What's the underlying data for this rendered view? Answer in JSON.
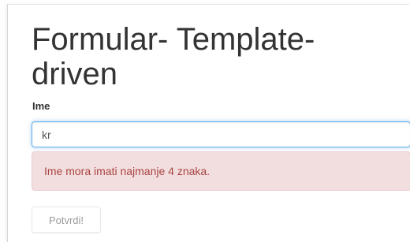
{
  "form": {
    "title": "Formular- Template-driven",
    "field_label": "Ime",
    "field_value": "kr",
    "error_message": "Ime mora imati najmanje 4 znaka.",
    "submit_label": "Potvrdi!"
  },
  "colors": {
    "focus_border": "#66afe9",
    "error_bg": "#f2dede",
    "error_text": "#a94442",
    "title_text": "#333333"
  }
}
